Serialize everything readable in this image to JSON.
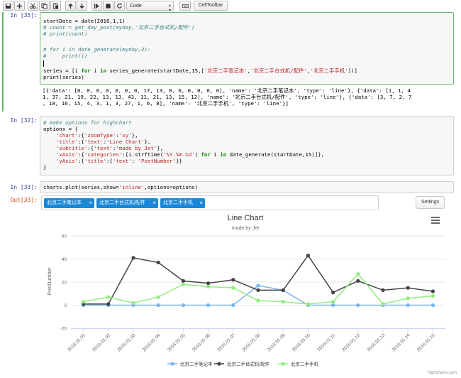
{
  "toolbar": {
    "buttons": [
      {
        "name": "save-icon"
      },
      {
        "name": "add-cell-icon"
      },
      {
        "name": "cut-icon"
      },
      {
        "name": "copy-icon"
      },
      {
        "name": "paste-icon"
      },
      {
        "name": "move-up-icon"
      },
      {
        "name": "move-down-icon"
      },
      {
        "name": "run-icon"
      },
      {
        "name": "stop-icon"
      },
      {
        "name": "restart-icon"
      }
    ],
    "cell_type": "Code",
    "keyboard_icon": "keyboard-icon",
    "cell_toolbar": "CellToolbar"
  },
  "cells": {
    "c35": {
      "prompt": "In [35]:",
      "line1": "startDate = date(2016,1,1)",
      "line2": "# count = get_day_post(myday,'北京二手台式机/配件')",
      "line3": "# print(count)",
      "line4": "# for i in date_generate(myday,3):",
      "line5": "#     print(i)",
      "line6_a": "series = [i ",
      "line6_for": "for",
      "line6_b": " i ",
      "line6_in": "in",
      "line6_c": " series_generate(startDate,15,[",
      "line6_s1": "'北京二手笔记本'",
      "line6_s2": "'北京二手台式机/配件'",
      "line6_s3": "'北京二手手机'",
      "line6_d": "])]",
      "line7": "print(series)",
      "output1": "[{'data': [0, 0, 0, 0, 0, 0, 0, 17, 13, 0, 0, 0, 0, 0, 0], 'name': '北京二手笔记本', 'type': 'line'}, {'data': [1, 1, 4",
      "output2": "1, 37, 21, 19, 22, 13, 13, 43, 11, 21, 13, 15, 12], 'name': '北京二手台式机/配件', 'type': 'line'}, {'data': [3, 7, 2, 7",
      "output3": ", 18, 16, 15, 4, 3, 1, 3, 27, 1, 6, 8], 'name': '北京二手手机', 'type': 'line'}]"
    },
    "c32": {
      "prompt": "In [32]:",
      "comment": "# make options for highchart",
      "l1": "options = {",
      "l2_k": "'chart'",
      "l2_v1": "'zoomType'",
      "l2_v2": "'xy'",
      "l3_k": "'title'",
      "l3_v1": "'text'",
      "l3_v2": "'Line Chart'",
      "l4_k": "'subtitle'",
      "l4_v1": "'text'",
      "l4_v2": "'made by Jet'",
      "l5_k": "'xAxis'",
      "l5_v1": "'categories'",
      "l5_v2": "'%Y.%m.%d'",
      "l6_k": "'yAxis'",
      "l6_v1": "'title'",
      "l6_v2": "'text'",
      "l6_v3": "'PostNumber'",
      "l7": "}"
    },
    "c33": {
      "prompt": "In [33]:",
      "code_a": "charts.plot(series,show=",
      "code_s": "'inline'",
      "code_b": ",options=options)",
      "out_prompt": "Out[33]:"
    }
  },
  "series_selector": {
    "tags": [
      "北京二手笔记本",
      "北京二手台式机/配件",
      "北京二手手机"
    ],
    "remove_glyph": "×",
    "settings_label": "Settings"
  },
  "chart_data": {
    "type": "line",
    "title": "Line Chart",
    "subtitle": "made by Jet",
    "ylabel": "PostNumber",
    "ylim": [
      -20,
      60
    ],
    "yticks": [
      -20,
      0,
      20,
      40,
      60
    ],
    "categories": [
      "2016.01.01",
      "2016.01.02",
      "2016.01.03",
      "2016.01.04",
      "2016.01.05",
      "2016.01.06",
      "2016.01.07",
      "2016.01.08",
      "2016.01.09",
      "2016.01.10",
      "2016.01.11",
      "2016.01.12",
      "2016.01.13",
      "2016.01.14",
      "2016.01.15"
    ],
    "series": [
      {
        "name": "北京二手笔记本",
        "color": "#7cb5ec",
        "values": [
          0,
          0,
          0,
          0,
          0,
          0,
          0,
          17,
          13,
          0,
          0,
          0,
          0,
          0,
          0
        ]
      },
      {
        "name": "北京二手台式机/配件",
        "color": "#434348",
        "values": [
          1,
          1,
          41,
          37,
          21,
          19,
          22,
          13,
          13,
          43,
          11,
          21,
          13,
          15,
          12
        ]
      },
      {
        "name": "北京二手手机",
        "color": "#90ed7d",
        "values": [
          3,
          7,
          2,
          7,
          18,
          16,
          15,
          4,
          3,
          1,
          3,
          27,
          1,
          6,
          8
        ]
      }
    ],
    "legend_position": "bottom",
    "grid": true,
    "menu_icon": "hamburger-menu-icon",
    "credits": "Highcharts.com"
  }
}
